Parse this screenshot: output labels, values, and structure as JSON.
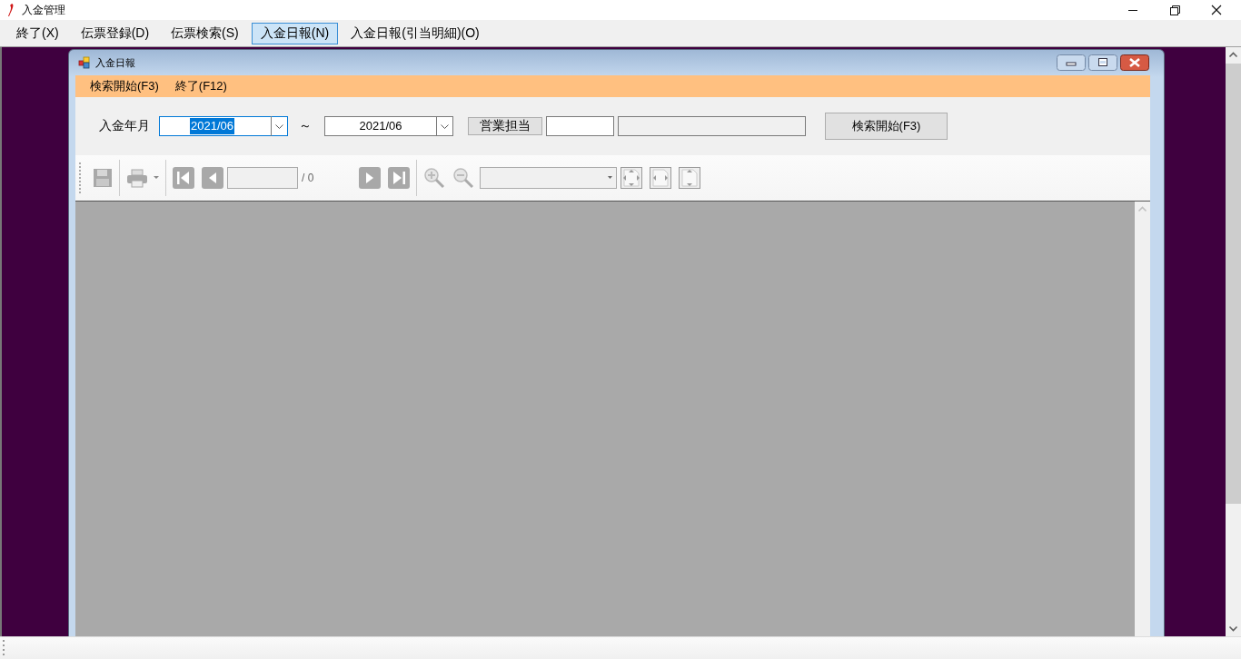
{
  "window": {
    "title": "入金管理"
  },
  "menu": [
    {
      "label": "終了(X)",
      "selected": false
    },
    {
      "label": "伝票登録(D)",
      "selected": false
    },
    {
      "label": "伝票検索(S)",
      "selected": false
    },
    {
      "label": "入金日報(N)",
      "selected": true
    },
    {
      "label": "入金日報(引当明細)(O)",
      "selected": false
    }
  ],
  "child_window": {
    "title": "入金日報",
    "menu": [
      "検索開始(F3)",
      "終了(F12)"
    ],
    "form": {
      "label": "入金年月",
      "date_from": {
        "value": "2021/06",
        "focused": true
      },
      "range_mark": "～",
      "date_to": {
        "value": "2021/06",
        "focused": false
      },
      "staff_button": "営業担当",
      "search_button": "検索開始(F3)"
    },
    "toolbar": {
      "page_total": "/ 0"
    }
  }
}
